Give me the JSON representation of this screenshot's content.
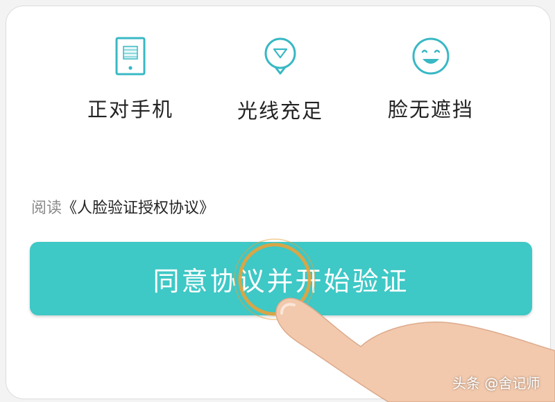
{
  "tips": [
    {
      "icon": "phone-icon",
      "label": "正对手机"
    },
    {
      "icon": "lightbulb-icon",
      "label": "光线充足"
    },
    {
      "icon": "smiley-face-icon",
      "label": "脸无遮挡"
    }
  ],
  "agreement": {
    "prefix": "阅读",
    "link_text": "《人脸验证授权协议》"
  },
  "primary_button": {
    "label": "同意协议并开始验证"
  },
  "watermark": "头条 @舍记师",
  "colors": {
    "accent": "#3ec8c6",
    "icon_stroke": "#38b8c4",
    "tap_ring": "#e8a23a"
  }
}
